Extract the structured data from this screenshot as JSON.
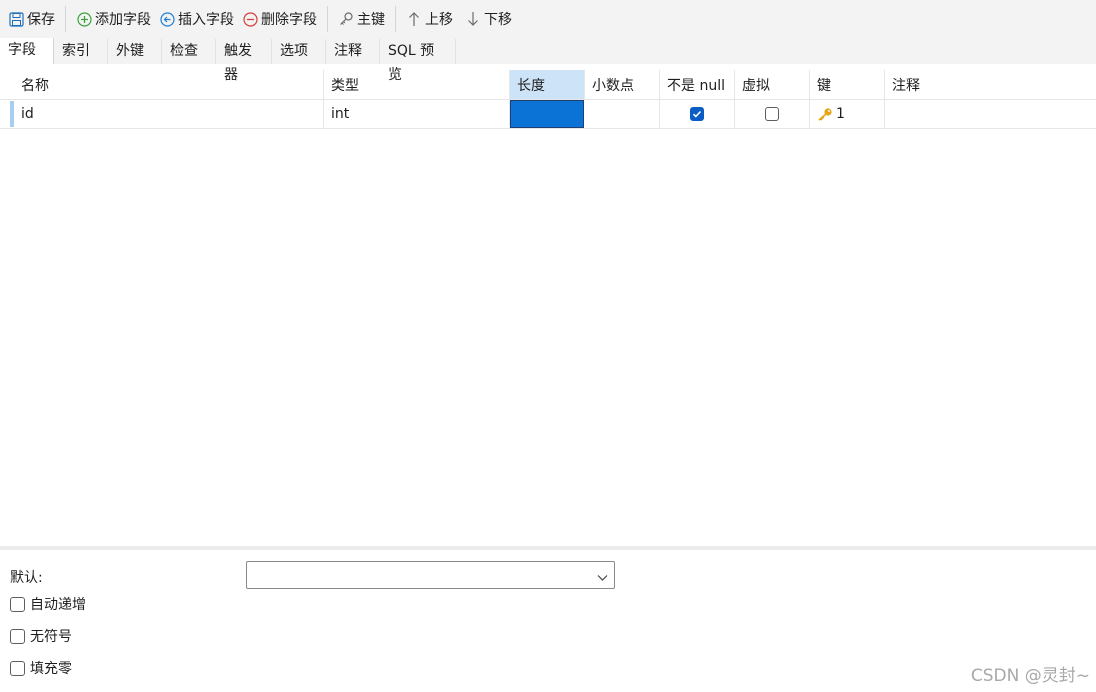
{
  "toolbar": {
    "save": "保存",
    "add_field": "添加字段",
    "insert_field": "插入字段",
    "delete_field": "删除字段",
    "primary_key": "主键",
    "move_up": "上移",
    "move_down": "下移"
  },
  "tabs": [
    "字段",
    "索引",
    "外键",
    "检查",
    "触发器",
    "选项",
    "注释",
    "SQL 预览"
  ],
  "columns": [
    "名称",
    "类型",
    "长度",
    "小数点",
    "不是 null",
    "虚拟",
    "键",
    "注释"
  ],
  "rows": [
    {
      "name": "id",
      "type": "int",
      "length": "",
      "decimals": "",
      "not_null": true,
      "virtual": false,
      "key": "1",
      "comment": ""
    }
  ],
  "bottom": {
    "default_label": "默认:",
    "default_value": "",
    "auto_increment": "自动递增",
    "unsigned": "无符号",
    "zerofill": "填充零"
  },
  "watermark": "CSDN @灵封~",
  "colors": {
    "accent": "#0b72d6",
    "header_selected": "#cde3f7",
    "checkbox": "#0b5cc4",
    "key_icon": "#e8a317"
  }
}
